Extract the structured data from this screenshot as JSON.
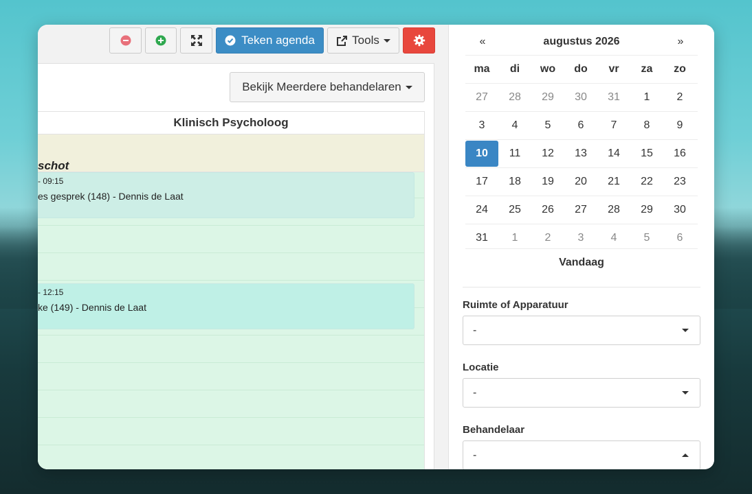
{
  "toolbar": {
    "teken_label": "Teken agenda",
    "tools_label": "Tools"
  },
  "agenda": {
    "filter_button": "Bekijk Meerdere behandelaren",
    "column_header": "Klinisch Psycholoog",
    "person_fragment": "schot",
    "events": [
      {
        "time": "- 09:15",
        "title": "es gesprek (148) - Dennis de Laat"
      },
      {
        "time": "- 12:15",
        "title": "ke (149) - Dennis de Laat"
      }
    ]
  },
  "calendar": {
    "prev": "«",
    "next": "»",
    "month_label": "augustus 2026",
    "weekdays": [
      "ma",
      "di",
      "wo",
      "do",
      "vr",
      "za",
      "zo"
    ],
    "weeks": [
      [
        {
          "d": "27",
          "m": true
        },
        {
          "d": "28",
          "m": true
        },
        {
          "d": "29",
          "m": true
        },
        {
          "d": "30",
          "m": true
        },
        {
          "d": "31",
          "m": true
        },
        {
          "d": "1"
        },
        {
          "d": "2"
        }
      ],
      [
        {
          "d": "3"
        },
        {
          "d": "4"
        },
        {
          "d": "5"
        },
        {
          "d": "6"
        },
        {
          "d": "7"
        },
        {
          "d": "8"
        },
        {
          "d": "9"
        }
      ],
      [
        {
          "d": "10",
          "sel": true
        },
        {
          "d": "11"
        },
        {
          "d": "12"
        },
        {
          "d": "13"
        },
        {
          "d": "14"
        },
        {
          "d": "15"
        },
        {
          "d": "16"
        }
      ],
      [
        {
          "d": "17"
        },
        {
          "d": "18"
        },
        {
          "d": "19"
        },
        {
          "d": "20"
        },
        {
          "d": "21"
        },
        {
          "d": "22"
        },
        {
          "d": "23"
        }
      ],
      [
        {
          "d": "24"
        },
        {
          "d": "25"
        },
        {
          "d": "26"
        },
        {
          "d": "27"
        },
        {
          "d": "28"
        },
        {
          "d": "29"
        },
        {
          "d": "30"
        }
      ],
      [
        {
          "d": "31"
        },
        {
          "d": "1",
          "m": true
        },
        {
          "d": "2",
          "m": true
        },
        {
          "d": "3",
          "m": true
        },
        {
          "d": "4",
          "m": true
        },
        {
          "d": "5",
          "m": true
        },
        {
          "d": "6",
          "m": true
        }
      ]
    ],
    "today_label": "Vandaag"
  },
  "filters": {
    "ruimte_label": "Ruimte of Apparatuur",
    "ruimte_value": "-",
    "locatie_label": "Locatie",
    "locatie_value": "-",
    "behandelaar_label": "Behandelaar",
    "behandelaar_value": "-"
  },
  "colors": {
    "primary": "#3c8dc5",
    "danger": "#e8473d",
    "event_bg": "#dcf6e6"
  }
}
